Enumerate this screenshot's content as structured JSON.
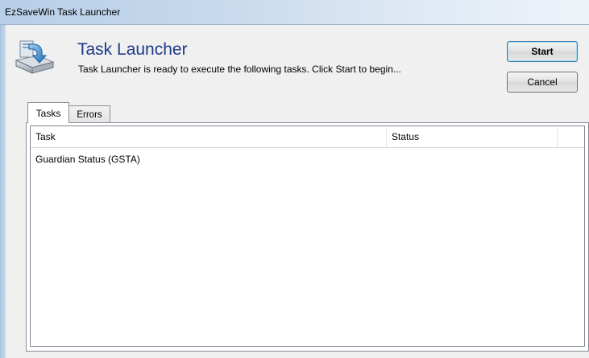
{
  "window": {
    "title": "EzSaveWin Task Launcher"
  },
  "header": {
    "heading": "Task Launcher",
    "description": "Task Launcher is ready to execute the following tasks. Click Start to begin...",
    "icon": "drive-download-icon"
  },
  "buttons": {
    "start_label": "Start",
    "cancel_label": "Cancel"
  },
  "tabs": [
    {
      "label": "Tasks",
      "selected": true
    },
    {
      "label": "Errors",
      "selected": false
    }
  ],
  "list": {
    "columns": [
      "Task",
      "Status"
    ],
    "rows": [
      {
        "task": "Guardian Status (GSTA)",
        "status": ""
      }
    ]
  }
}
